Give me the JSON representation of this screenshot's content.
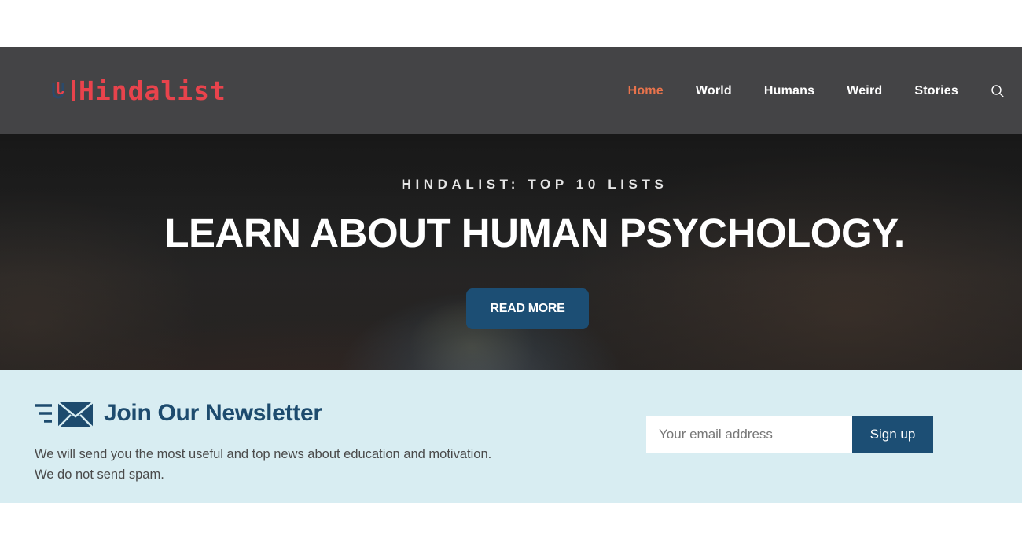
{
  "header": {
    "logo_text": "Hindalist",
    "nav": [
      {
        "label": "Home",
        "active": true
      },
      {
        "label": "World",
        "active": false
      },
      {
        "label": "Humans",
        "active": false
      },
      {
        "label": "Weird",
        "active": false
      },
      {
        "label": "Stories",
        "active": false
      }
    ],
    "search_icon": "search-icon"
  },
  "hero": {
    "kicker": "HINDALIST: TOP 10 LISTS",
    "title": "LEARN ABOUT HUMAN PSYCHOLOGY.",
    "button_label": "READ MORE"
  },
  "newsletter": {
    "icon": "newsletter-mail-icon",
    "title": "Join Our Newsletter",
    "description": "We will send you the most useful and top news about education and motivation. We do not send spam.",
    "email_placeholder": "Your email address",
    "email_value": "",
    "signup_label": "Sign up"
  },
  "colors": {
    "header_bg": "#444446",
    "brand_red": "#e8434c",
    "nav_active": "#e8734c",
    "primary_blue": "#1c4e74",
    "newsletter_bg": "#d8edf2"
  }
}
